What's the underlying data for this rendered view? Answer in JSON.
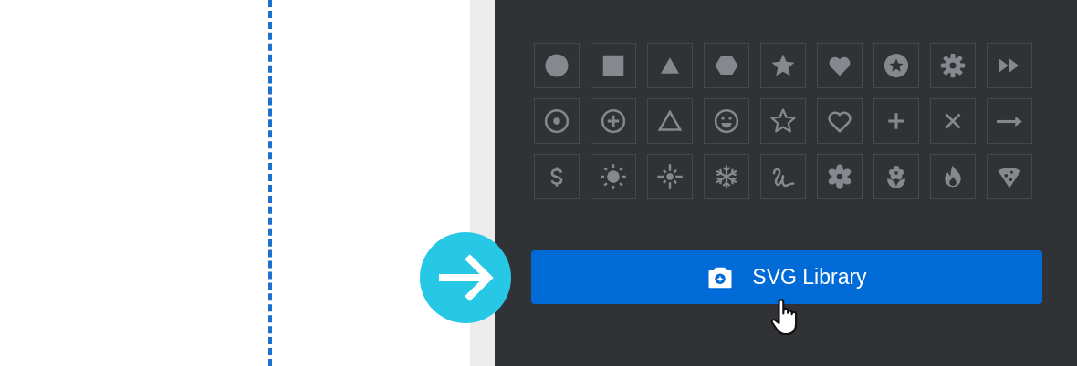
{
  "library_button": {
    "label": "SVG Library"
  }
}
